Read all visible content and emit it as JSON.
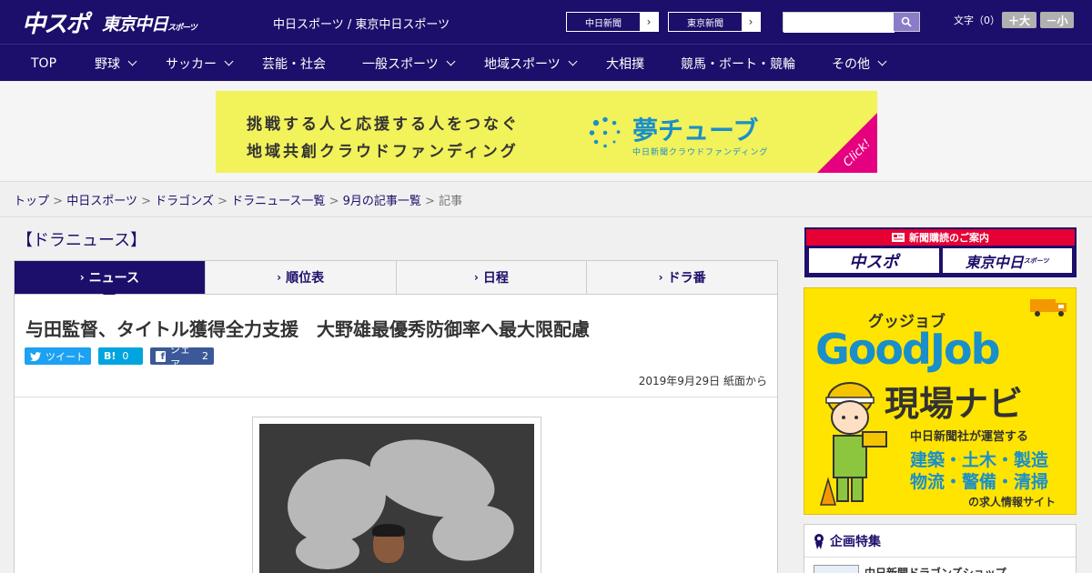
{
  "header": {
    "logo_main": "中スポ",
    "logo_tokyo": "東京中日",
    "logo_tokyo_small": "スポーツ",
    "site_names": "中日スポーツ / 東京中日スポーツ",
    "paper_buttons": [
      "中日新聞",
      "東京新聞"
    ],
    "search": {
      "placeholder": ""
    },
    "font_size_label": "文字（0）",
    "font_larger": "＋大",
    "font_smaller": "－小"
  },
  "nav": {
    "items": [
      {
        "label": "TOP",
        "dropdown": false
      },
      {
        "label": "野球",
        "dropdown": true
      },
      {
        "label": "サッカー",
        "dropdown": true
      },
      {
        "label": "芸能・社会",
        "dropdown": false
      },
      {
        "label": "一般スポーツ",
        "dropdown": true
      },
      {
        "label": "地域スポーツ",
        "dropdown": true
      },
      {
        "label": "大相撲",
        "dropdown": false
      },
      {
        "label": "競馬・ボート・競輪",
        "dropdown": false
      },
      {
        "label": "その他",
        "dropdown": true
      }
    ]
  },
  "ad_banner": {
    "line1": "挑戦する人と応援する人をつなぐ",
    "line2": "地域共創クラウドファンディング",
    "brand": "夢チューブ",
    "brand_sub": "中日新聞クラウドファンディング",
    "cta": "Click!"
  },
  "breadcrumb": {
    "items": [
      "トップ",
      "中日スポーツ",
      "ドラゴンズ",
      "ドラニュース一覧",
      "9月の記事一覧"
    ],
    "current": "記事",
    "separator": ">"
  },
  "section_title": "【ドラニュース】",
  "tabs": [
    {
      "label": "ニュース",
      "active": true
    },
    {
      "label": "順位表",
      "active": false
    },
    {
      "label": "日程",
      "active": false
    },
    {
      "label": "ドラ番",
      "active": false
    }
  ],
  "article": {
    "headline": "与田監督、タイトル獲得全力支援　大野雄最優秀防御率へ最大限配慮",
    "share": {
      "tweet": "ツイート",
      "hatena_label": "B!",
      "hatena_count": "0",
      "facebook": "シェア",
      "facebook_count": "2"
    },
    "date": "2019年9月29日 紙面から"
  },
  "sidebar": {
    "subscribe_header": "新聞購読のご案内",
    "subscribe_options": [
      "中スポ",
      "東京中日"
    ],
    "subscribe_small": "スポーツ",
    "goodjob": {
      "kana": "グッジョブ",
      "title": "GoodJob",
      "subtitle": "現場ナビ",
      "line1": "中日新聞社が運営する",
      "line2": "建築・土木・製造",
      "line3": "物流・警備・清掃",
      "line4": "の求人情報サイト"
    },
    "plan_header": "企画特集",
    "plan_item": "中日新聞ドラゴンズショップ"
  },
  "colors": {
    "brand_navy": "#1c0f6b",
    "accent_red": "#e60033",
    "twitter": "#1da1f2",
    "hatena": "#00a4de",
    "facebook": "#3b5998"
  }
}
